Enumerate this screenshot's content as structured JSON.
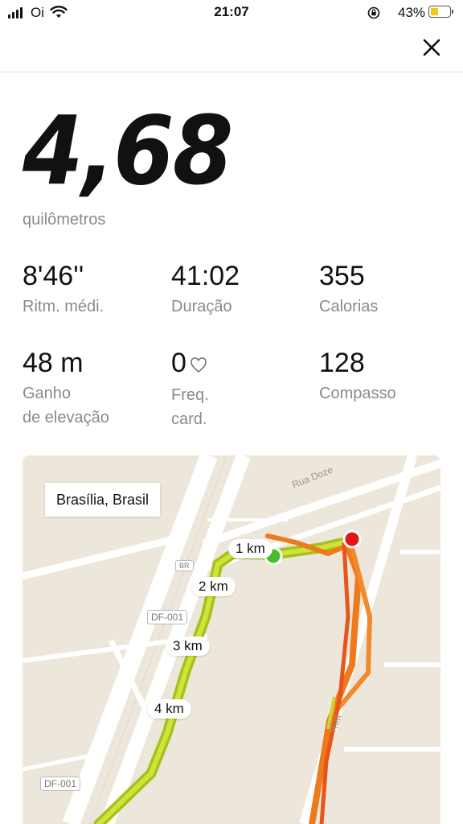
{
  "status_bar": {
    "carrier": "Oi",
    "time": "21:07",
    "battery_percent": "43%",
    "battery_level": 0.43,
    "battery_color": "#f5c518"
  },
  "header": {
    "close_icon": "close-x-icon"
  },
  "summary": {
    "distance": "4,68",
    "distance_unit": "quilômetros"
  },
  "stats": {
    "pace": {
      "value": "8'46''",
      "label": "Ritm. médi."
    },
    "duration": {
      "value": "41:02",
      "label": "Duração"
    },
    "calories": {
      "value": "355",
      "label": "Calorias"
    },
    "elevation": {
      "value": "48 m",
      "label_line1": "Ganho",
      "label_line2": "de elevação"
    },
    "heart_rate": {
      "value": "0",
      "label_line1": "Freq.",
      "label_line2": "card.",
      "icon": "heart-icon"
    },
    "cadence": {
      "value": "128",
      "label": "Compasso"
    }
  },
  "map": {
    "location": "Brasília, Brasil",
    "km_markers": [
      "1 km",
      "2 km",
      "3 km",
      "4 km"
    ],
    "road_signs": [
      "DF-001",
      "DF-001",
      "BR"
    ],
    "streets": [
      "Rua Doze",
      "Rua"
    ],
    "start_color": "#44c02a",
    "end_color": "#e8141b",
    "route_colors": [
      "#b9d42a",
      "#ef7a1c"
    ]
  }
}
